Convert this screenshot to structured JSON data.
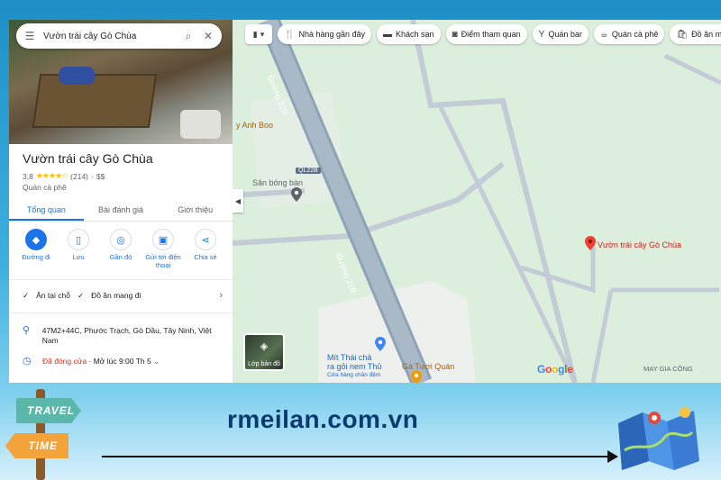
{
  "search": {
    "value": "Vườn trái cây Gò Chùa"
  },
  "place": {
    "name": "Vườn trái cây Gò Chùa",
    "rating": "3,8",
    "stars": 3.8,
    "reviews": "(214)",
    "separator": "·",
    "price": "$$",
    "category": "Quán cà phê"
  },
  "tabs": [
    {
      "label": "Tổng quan"
    },
    {
      "label": "Bài đánh giá"
    },
    {
      "label": "Giới thiệu"
    }
  ],
  "actions": [
    {
      "label": "Đường đi",
      "icon": "directions-icon"
    },
    {
      "label": "Lưu",
      "icon": "bookmark-icon"
    },
    {
      "label": "Gần đó",
      "icon": "nearby-icon"
    },
    {
      "label": "Gửi tới điện thoại",
      "icon": "phone-icon"
    },
    {
      "label": "Chia sẻ",
      "icon": "share-icon"
    }
  ],
  "features": {
    "dine_in": "Ăn tại chỗ",
    "takeaway": "Đồ ăn mang đi"
  },
  "address": "47M2+44C, Phước Trạch, Gò Dầu, Tây Ninh, Việt Nam",
  "hours": {
    "status": "Đã đóng cửa",
    "next": " · Mở lúc 9:00 Th 5"
  },
  "chips": [
    {
      "label": "Nhà hàng gần đây",
      "icon": "restaurant-icon"
    },
    {
      "label": "Khách sạn",
      "icon": "hotel-icon"
    },
    {
      "label": "Điểm tham quan",
      "icon": "camera-icon"
    },
    {
      "label": "Quán bar",
      "icon": "bar-icon"
    },
    {
      "label": "Quán cà phê",
      "icon": "coffee-icon"
    },
    {
      "label": "Đồ ăn mang đi",
      "icon": "takeout-icon"
    }
  ],
  "map": {
    "road_label_top": "Đường 22B",
    "road_label_bottom": "Đường 22B",
    "route_shield": "QL22B",
    "poi_anh_boo": "y Anh Boo",
    "poi_stadium": "Sân bóng bàn",
    "poi_destination": "Vườn trái cây Gò Chùa",
    "poi_mit_thai_1": "Mít Thái chả",
    "poi_mit_thai_2": "ra gỏi nem Thủ",
    "poi_mit_thai_3": "Cửa hàng chăn đệm",
    "poi_ga_tuoi": "Gà Tươi Quán",
    "poi_may_gia_cong": "MAY GIA CÔNG",
    "layers_label": "Lớp bản đồ",
    "google": [
      "G",
      "o",
      "o",
      "g",
      "l",
      "e"
    ]
  },
  "banner": {
    "travel": "TRAVEL",
    "time": "TIME",
    "url": "rmeilan.com.vn"
  },
  "colors": {
    "accent": "#1a73e8",
    "closed": "#d93025",
    "star": "#fbbc04",
    "url": "#0b3b6e"
  }
}
